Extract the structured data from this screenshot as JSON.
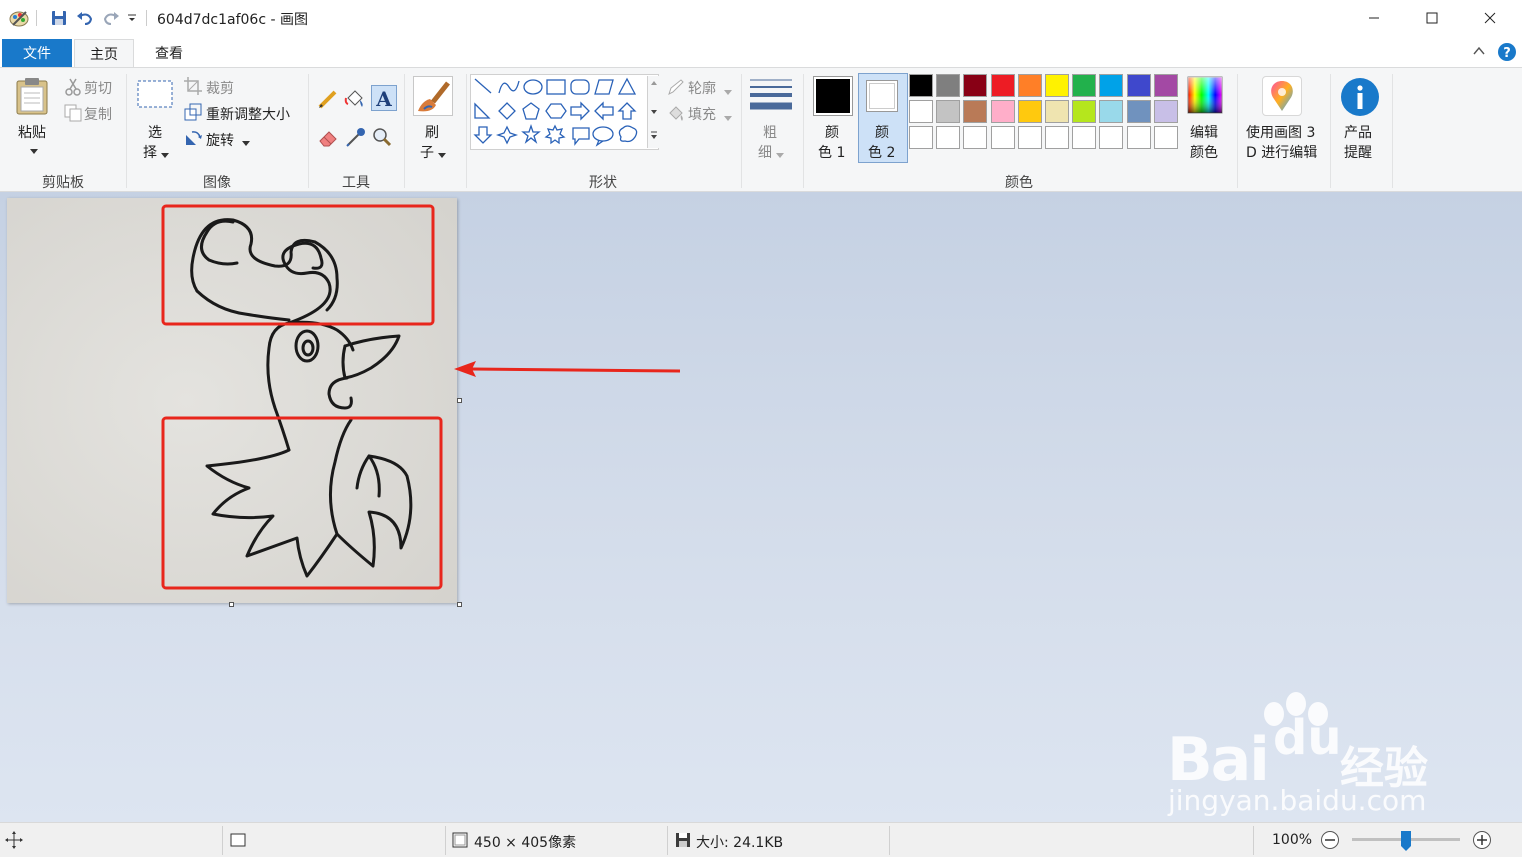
{
  "window": {
    "title": "604d7dc1af06c - 画图"
  },
  "menu": {
    "tabs": [
      "文件",
      "主页",
      "查看"
    ]
  },
  "ribbon": {
    "clipboard": {
      "label": "剪贴板",
      "paste": "粘贴",
      "cut": "剪切",
      "copy": "复制"
    },
    "image": {
      "label": "图像",
      "select_top": "选",
      "select_bottom": "择",
      "crop": "裁剪",
      "resize": "重新调整大小",
      "rotate": "旋转"
    },
    "tools": {
      "label": "工具"
    },
    "brush": {
      "top": "刷",
      "bottom": "子"
    },
    "shapes": {
      "label": "形状",
      "outline": "轮廓",
      "fill": "填充"
    },
    "size": {
      "top": "粗",
      "bottom": "细"
    },
    "colors": {
      "label": "颜色",
      "color1_top": "颜",
      "color1_bottom": "色 1",
      "color2_top": "颜",
      "color2_bottom": "色 2",
      "edit_top": "编辑",
      "edit_bottom": "颜色",
      "palette_row1": [
        "#000000",
        "#7f7f7f",
        "#880015",
        "#ed1c24",
        "#ff7f27",
        "#fff200",
        "#22b14c",
        "#00a2e8",
        "#3f48cc",
        "#a349a4"
      ],
      "palette_row2": [
        "#ffffff",
        "#c3c3c3",
        "#b97a57",
        "#ffaec9",
        "#ffc90e",
        "#efe4b0",
        "#b5e61d",
        "#99d9ea",
        "#7092be",
        "#c8bfe7"
      ]
    },
    "paint3d": {
      "top": "使用画图 3",
      "bottom": "D 进行编辑"
    },
    "product": {
      "top": "产品",
      "bottom": "提醒"
    }
  },
  "watermark": {
    "bai": "Bai",
    "du": "du",
    "jingyan": "经验",
    "url": "jingyan.baidu.com"
  },
  "status": {
    "dimensions": "450 × 405像素",
    "size": "大小: 24.1KB",
    "zoom": "100%"
  }
}
